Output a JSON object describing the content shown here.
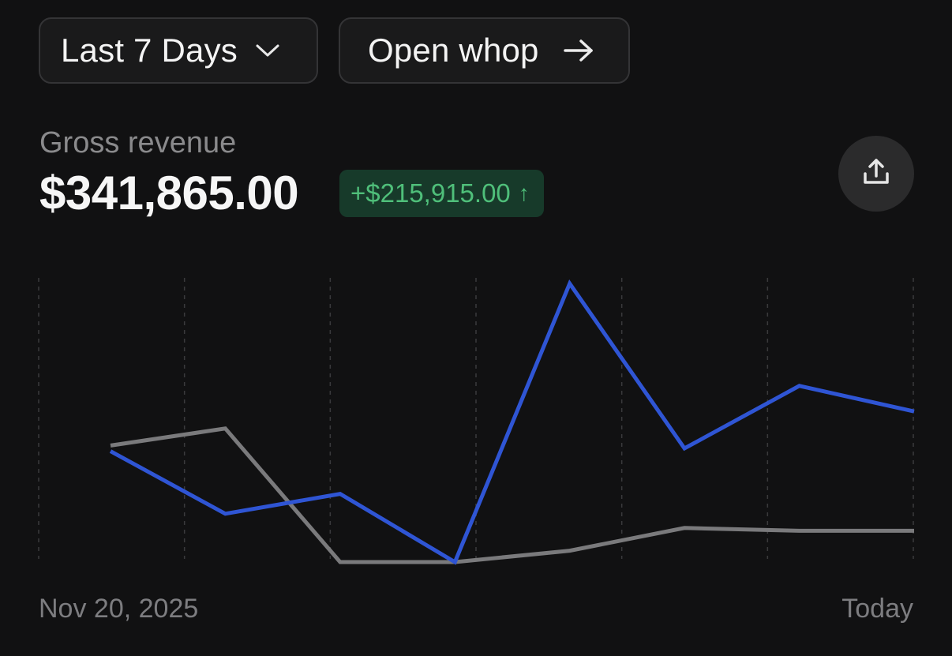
{
  "controls": {
    "range_label": "Last 7 Days",
    "open_label": "Open whop"
  },
  "metric": {
    "label": "Gross revenue",
    "value": "$341,865.00",
    "delta": "+$215,915.00",
    "delta_arrow": "↑"
  },
  "icons": {
    "range": "chevron-down-icon",
    "open": "arrow-right-icon",
    "share": "share-upload-icon"
  },
  "colors": {
    "current_series": "#2f55d4",
    "previous_series": "#7a7a7c",
    "delta_bg": "#173a2a",
    "delta_text": "#4fbf7a"
  },
  "chart_data": {
    "type": "line",
    "x_start_label": "Nov 20, 2025",
    "x_end_label": "Today",
    "grid": "vertical-dashed",
    "points": 8,
    "series": [
      {
        "key": "current",
        "values": [
          39,
          17,
          24,
          0,
          98,
          40,
          62,
          53
        ]
      },
      {
        "key": "previous",
        "values": [
          41,
          47,
          0,
          0,
          4,
          12,
          11,
          11
        ]
      }
    ],
    "ylim": [
      0,
      100
    ]
  }
}
